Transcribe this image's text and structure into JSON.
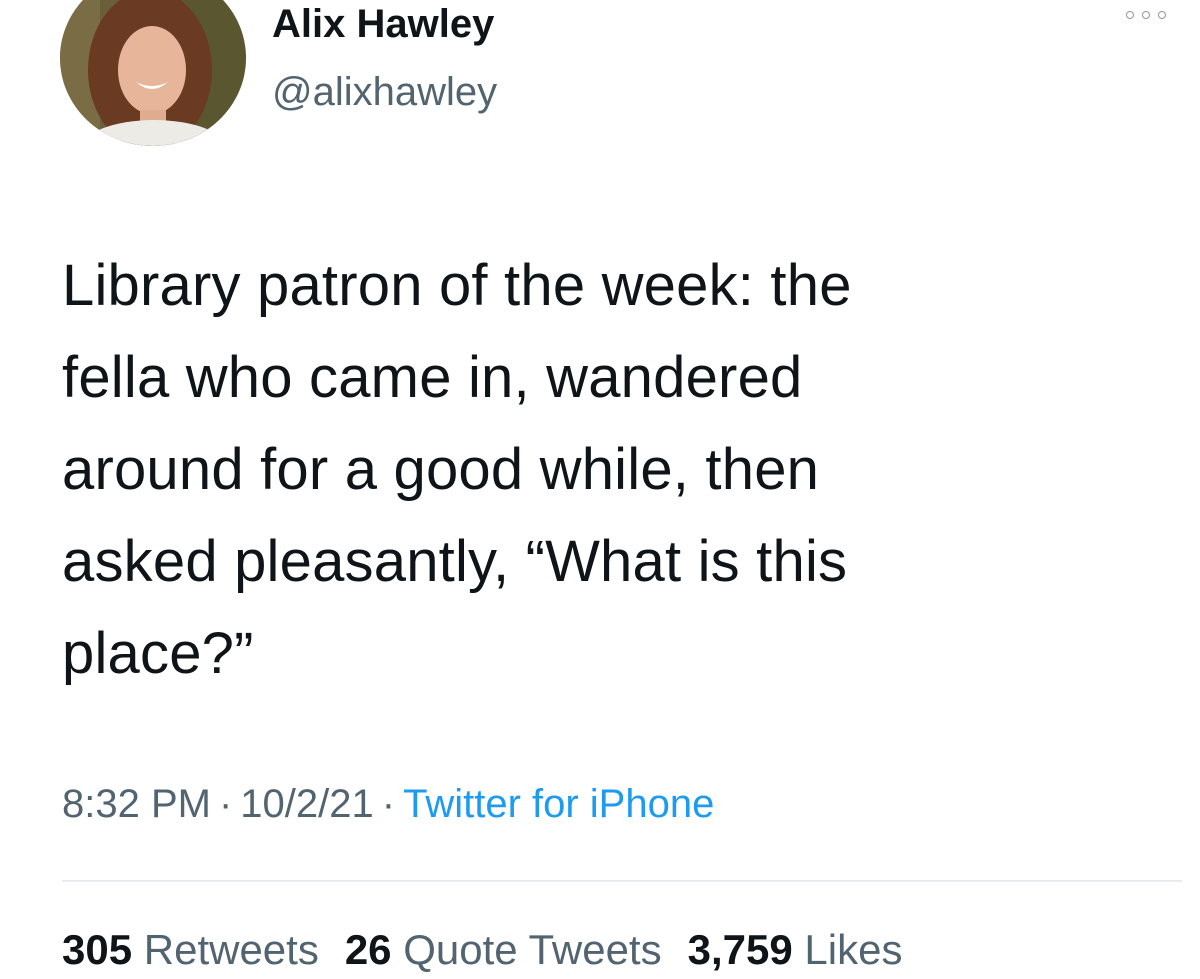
{
  "author": {
    "display_name": "Alix Hawley",
    "handle": "@alixhawley"
  },
  "icons": {
    "avatar": "profile-photo",
    "more": "more-options-icon"
  },
  "tweet": {
    "text": "Library patron of the week: the\nfella who came in, wandered\naround for a good while, then\nasked pleasantly, “What is this\nplace?”"
  },
  "meta": {
    "time": "8:32 PM",
    "separator": "·",
    "date": "10/2/21",
    "source": "Twitter for iPhone"
  },
  "stats": {
    "retweets_count": "305",
    "retweets_label": "Retweets",
    "quotes_count": "26",
    "quotes_label": "Quote Tweets",
    "likes_count": "3,759",
    "likes_label": "Likes"
  },
  "colors": {
    "text": "#0f1419",
    "secondary": "#536471",
    "link": "#1d9bf0",
    "divider": "#e6ecf0"
  }
}
